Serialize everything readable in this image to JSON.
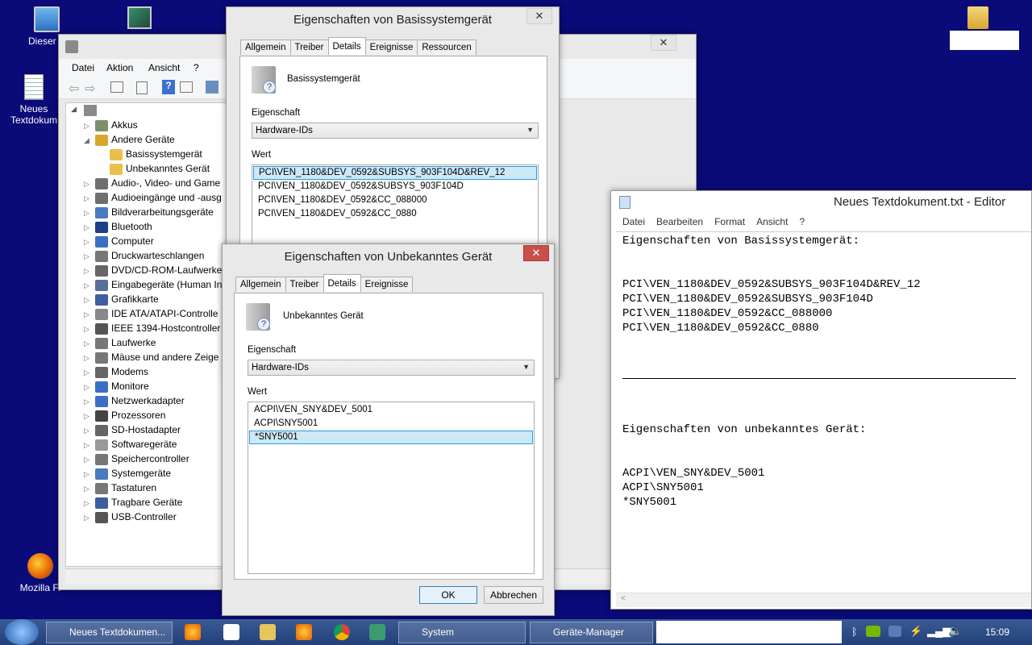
{
  "desktop": {
    "icons": [
      {
        "label": "Dieser P"
      },
      {
        "label": "Neues Textdokum"
      },
      {
        "label": "Mozilla Fi"
      }
    ]
  },
  "device_manager": {
    "menu": [
      "Datei",
      "Aktion",
      "Ansicht",
      "?"
    ],
    "tree": [
      {
        "label": "Akkus",
        "level": 1,
        "expander": "▷"
      },
      {
        "label": "Andere Geräte",
        "level": 1,
        "expander": "◢"
      },
      {
        "label": "Basissystemgerät",
        "level": 2,
        "expander": ""
      },
      {
        "label": "Unbekanntes Gerät",
        "level": 2,
        "expander": ""
      },
      {
        "label": "Audio-, Video- und Game",
        "level": 1,
        "expander": "▷"
      },
      {
        "label": "Audioeingänge und -ausg",
        "level": 1,
        "expander": "▷"
      },
      {
        "label": "Bildverarbeitungsgeräte",
        "level": 1,
        "expander": "▷"
      },
      {
        "label": "Bluetooth",
        "level": 1,
        "expander": "▷"
      },
      {
        "label": "Computer",
        "level": 1,
        "expander": "▷"
      },
      {
        "label": "Druckwarteschlangen",
        "level": 1,
        "expander": "▷"
      },
      {
        "label": "DVD/CD-ROM-Laufwerke",
        "level": 1,
        "expander": "▷"
      },
      {
        "label": "Eingabegeräte (Human In",
        "level": 1,
        "expander": "▷"
      },
      {
        "label": "Grafikkarte",
        "level": 1,
        "expander": "▷"
      },
      {
        "label": "IDE ATA/ATAPI-Controlle",
        "level": 1,
        "expander": "▷"
      },
      {
        "label": "IEEE 1394-Hostcontroller",
        "level": 1,
        "expander": "▷"
      },
      {
        "label": "Laufwerke",
        "level": 1,
        "expander": "▷"
      },
      {
        "label": "Mäuse und andere Zeige",
        "level": 1,
        "expander": "▷"
      },
      {
        "label": "Modems",
        "level": 1,
        "expander": "▷"
      },
      {
        "label": "Monitore",
        "level": 1,
        "expander": "▷"
      },
      {
        "label": "Netzwerkadapter",
        "level": 1,
        "expander": "▷"
      },
      {
        "label": "Prozessoren",
        "level": 1,
        "expander": "▷"
      },
      {
        "label": "SD-Hostadapter",
        "level": 1,
        "expander": "▷"
      },
      {
        "label": "Softwaregeräte",
        "level": 1,
        "expander": "▷"
      },
      {
        "label": "Speichercontroller",
        "level": 1,
        "expander": "▷"
      },
      {
        "label": "Systemgeräte",
        "level": 1,
        "expander": "▷"
      },
      {
        "label": "Tastaturen",
        "level": 1,
        "expander": "▷"
      },
      {
        "label": "Tragbare Geräte",
        "level": 1,
        "expander": "▷"
      },
      {
        "label": "USB-Controller",
        "level": 1,
        "expander": "▷"
      }
    ]
  },
  "dialog_basis": {
    "title": "Eigenschaften von Basissystemgerät",
    "tabs": [
      "Allgemein",
      "Treiber",
      "Details",
      "Ereignisse",
      "Ressourcen"
    ],
    "active_tab": "Details",
    "device_name": "Basissystemgerät",
    "property_label": "Eigenschaft",
    "property_value": "Hardware-IDs",
    "value_label": "Wert",
    "values": [
      "PCI\\VEN_1180&DEV_0592&SUBSYS_903F104D&REV_12",
      "PCI\\VEN_1180&DEV_0592&SUBSYS_903F104D",
      "PCI\\VEN_1180&DEV_0592&CC_088000",
      "PCI\\VEN_1180&DEV_0592&CC_0880"
    ],
    "close": "✕"
  },
  "dialog_unknown": {
    "title": "Eigenschaften von Unbekanntes Gerät",
    "tabs": [
      "Allgemein",
      "Treiber",
      "Details",
      "Ereignisse"
    ],
    "active_tab": "Details",
    "device_name": "Unbekanntes Gerät",
    "property_label": "Eigenschaft",
    "property_value": "Hardware-IDs",
    "value_label": "Wert",
    "values": [
      "ACPI\\VEN_SNY&DEV_5001",
      "ACPI\\SNY5001",
      "*SNY5001"
    ],
    "ok": "OK",
    "cancel": "Abbrechen",
    "close": "✕"
  },
  "notepad": {
    "title": "Neues Textdokument.txt - Editor",
    "menu": [
      "Datei",
      "Bearbeiten",
      "Format",
      "Ansicht",
      "?"
    ],
    "lines": [
      "Eigenschaften von Basissystemgerät:",
      "",
      "",
      "PCI\\VEN_1180&DEV_0592&SUBSYS_903F104D&REV_12",
      "PCI\\VEN_1180&DEV_0592&SUBSYS_903F104D",
      "PCI\\VEN_1180&DEV_0592&CC_088000",
      "PCI\\VEN_1180&DEV_0592&CC_0880",
      "",
      "",
      "___",
      "",
      "",
      "",
      "Eigenschaften von unbekanntes Gerät:",
      "",
      "",
      "ACPI\\VEN_SNY&DEV_5001",
      "ACPI\\SNY5001",
      "*SNY5001"
    ]
  },
  "taskbar": {
    "buttons": [
      "Neues Textdokumen...",
      "System",
      "Geräte-Manager"
    ],
    "time": "15:09"
  }
}
